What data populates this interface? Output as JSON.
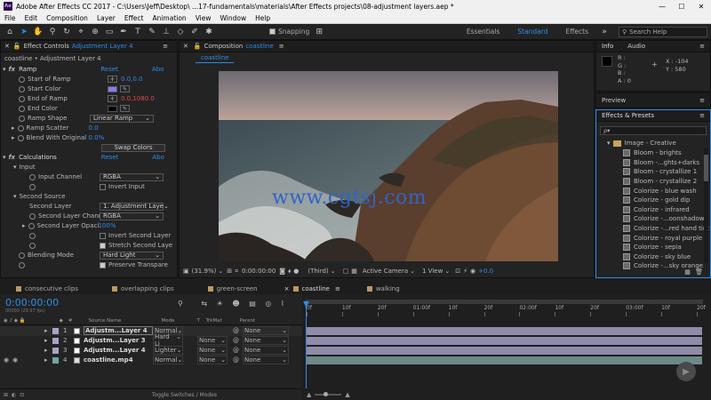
{
  "app": {
    "title": "Adobe After Effects CC 2017 - C:\\Users\\Jeff\\Desktop\\ ...17-fundamentals\\materials\\After Effects projects\\08-adjustment layers.aep *",
    "logo": "Ae"
  },
  "menu": [
    "File",
    "Edit",
    "Composition",
    "Layer",
    "Effect",
    "Animation",
    "View",
    "Window",
    "Help"
  ],
  "toolbar": {
    "snapping": "Snapping",
    "workspaces": [
      "Essentials",
      "Standard",
      "Effects"
    ],
    "active_workspace": "Standard",
    "search_help": "Search Help"
  },
  "effect_controls": {
    "header_label": "Effect Controls",
    "header_layer": "Adjustment Layer 4",
    "breadcrumb": "coastline • Adjustment Layer 4",
    "ramp": {
      "name": "Ramp",
      "reset": "Reset",
      "about": "Abo",
      "start_of_ramp_label": "Start of Ramp",
      "start_of_ramp_value": "0.0,0.0",
      "start_color_label": "Start Color",
      "start_color": "#8a7cf0",
      "end_of_ramp_label": "End of Ramp",
      "end_of_ramp_value": "0.0,1080.0",
      "end_color_label": "End Color",
      "end_color": "#000000",
      "ramp_shape_label": "Ramp Shape",
      "ramp_shape_value": "Linear Ramp",
      "ramp_scatter_label": "Ramp Scatter",
      "ramp_scatter_value": "0.0",
      "blend_label": "Blend With Original",
      "blend_value": "0.0%",
      "swap_colors": "Swap Colors"
    },
    "calculations": {
      "name": "Calculations",
      "reset": "Reset",
      "about": "Abo",
      "input_label": "Input",
      "input_channel_label": "Input Channel",
      "input_channel_value": "RGBA",
      "invert_input": "Invert Input",
      "second_source_label": "Second Source",
      "second_layer_label": "Second Layer",
      "second_layer_value": "1. Adjustment Laye",
      "second_layer_channel_label": "Second Layer Chann",
      "second_layer_channel_value": "RGBA",
      "second_layer_opacity_label": "Second Layer Opaci",
      "second_layer_opacity_value": "100%",
      "invert_second_layer": "Invert Second Layer",
      "stretch_second_layer": "Stretch Second Laye",
      "blending_mode_label": "Blending Mode",
      "blending_mode_value": "Hard Light",
      "preserve_transparency": "Preserve Transpare"
    }
  },
  "composition": {
    "header_label": "Composition",
    "header_name": "coastline",
    "tab": "coastline",
    "watermark": "www.cgtsj.com",
    "zoom": "(31.9%)",
    "timecode": "0:00:00:00",
    "view": "(Third)",
    "camera": "Active Camera",
    "views": "1 View",
    "exposure": "+0.0"
  },
  "info": {
    "tabs": [
      "Info",
      "Audio"
    ],
    "r": "R :",
    "g": "G :",
    "b": "B :",
    "a": "A :  0",
    "x": "X : -104",
    "y": "Y : 580"
  },
  "preview": {
    "title": "Preview"
  },
  "effects_presets": {
    "title": "Effects & Presets",
    "search_placeholder": "ρ▾",
    "folder": "Image - Creative",
    "items": [
      "Bloom - brights",
      "Bloom -...ghts+darks",
      "Bloom - crystallize 1",
      "Bloom - crystallize 2",
      "Colorize - blue wash",
      "Colorize - gold dip",
      "Colorize - infrared",
      "Colorize -...oonshadows",
      "Colorize -...red hand tint",
      "Colorize - royal purple",
      "Colorize - sepia",
      "Colorize - sky blue",
      "Colorize -...sky orange"
    ]
  },
  "timeline": {
    "tabs": [
      "consecutive clips",
      "overlapping clips",
      "green-screen",
      "coastline",
      "walking"
    ],
    "active_tab": "coastline",
    "timecode": "0:00:00:00",
    "fps": "00000 (29.97 fps)",
    "columns": {
      "num": "#",
      "source": "Source Name",
      "mode": "Mode",
      "t": "T",
      "trkmat": "TrkMat",
      "parent": "Parent"
    },
    "ruler": [
      "0f",
      "10f",
      "20f",
      "01:00f",
      "10f",
      "20f",
      "02:00f",
      "10f",
      "20f",
      "03:00f",
      "10f",
      "20f"
    ],
    "layers": [
      {
        "num": "1",
        "name": "Adjustm...Layer 4",
        "mode": "Normal",
        "trkmat": "",
        "parent": "None"
      },
      {
        "num": "2",
        "name": "Adjustm...Layer 3",
        "mode": "Hard Li",
        "trkmat": "None",
        "parent": "None"
      },
      {
        "num": "3",
        "name": "Adjustm...Layer 4",
        "mode": "Lighter",
        "trkmat": "None",
        "parent": "None"
      },
      {
        "num": "4",
        "name": "coastline.mp4",
        "mode": "Normal",
        "trkmat": "None",
        "parent": "None"
      }
    ],
    "toggle": "Toggle Switches / Modes"
  }
}
